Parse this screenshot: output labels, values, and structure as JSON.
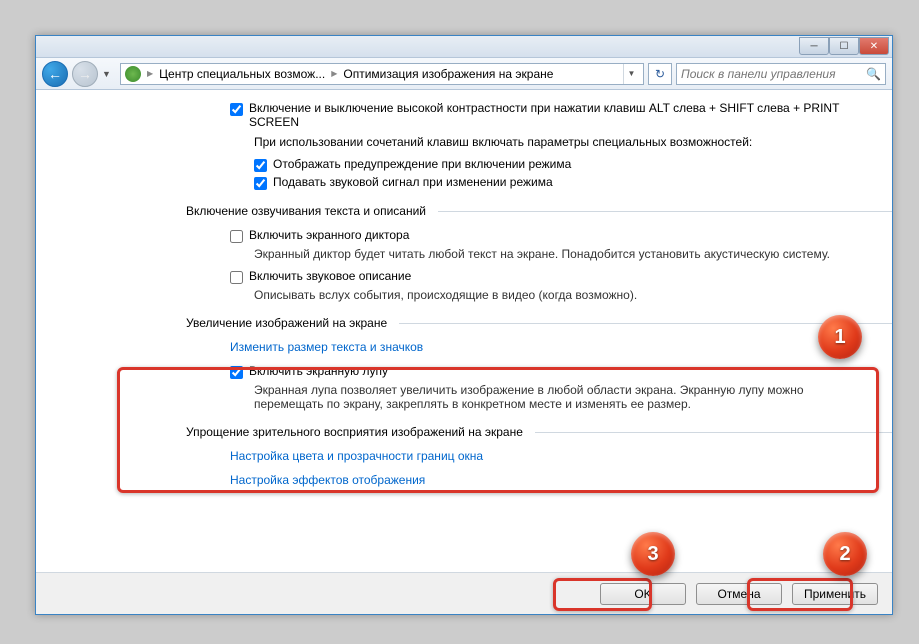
{
  "titlebar": {
    "minimize_glyph": "─",
    "maximize_glyph": "☐",
    "close_glyph": "✕"
  },
  "nav": {
    "back_glyph": "←",
    "forward_glyph": "→",
    "dropdown_glyph": "▼",
    "refresh_glyph": "↻",
    "address_segment_1": "Центр специальных возмож...",
    "address_segment_2": "Оптимизация изображения на экране",
    "search_placeholder": "Поиск в панели управления",
    "search_icon": "🔍"
  },
  "content": {
    "cb_high_contrast_toggle": "Включение и выключение высокой контрастности при нажатии клавиш ALT слева + SHIFT слева + PRINT SCREEN",
    "note_when_shortcut": "При использовании сочетаний клавиш включать параметры специальных возможностей:",
    "cb_show_warning": "Отображать предупреждение при включении режима",
    "cb_sound_signal": "Подавать звуковой сигнал при изменении режима",
    "sect_narration": "Включение озвучивания текста и описаний",
    "cb_narrator": "Включить экранного диктора",
    "narrator_desc": "Экранный диктор будет читать любой текст на экране. Понадобится установить акустическую систему.",
    "cb_audio_desc": "Включить звуковое описание",
    "audio_desc_desc": "Описывать вслух события, происходящие в видео (когда возможно).",
    "sect_magnify": "Увеличение изображений на экране",
    "link_resize_text": "Изменить размер текста и значков",
    "cb_magnifier": "Включить экранную лупу",
    "magnifier_desc": "Экранная лупа позволяет увеличить изображение в любой области экрана. Экранную лупу можно перемещать по экрану, закреплять в конкретном месте и изменять ее размер.",
    "sect_visual": "Упрощение зрительного восприятия изображений на экране",
    "link_color_trans": "Настройка цвета и прозрачности границ окна",
    "link_display_fx": "Настройка эффектов отображения"
  },
  "footer": {
    "ok": "OK",
    "cancel": "Отмена",
    "apply": "Применить"
  },
  "checkbox_states": {
    "high_contrast": true,
    "show_warning": true,
    "sound_signal": true,
    "narrator": false,
    "audio_desc": false,
    "magnifier": true
  },
  "markers": {
    "m1": "1",
    "m2": "2",
    "m3": "3"
  }
}
